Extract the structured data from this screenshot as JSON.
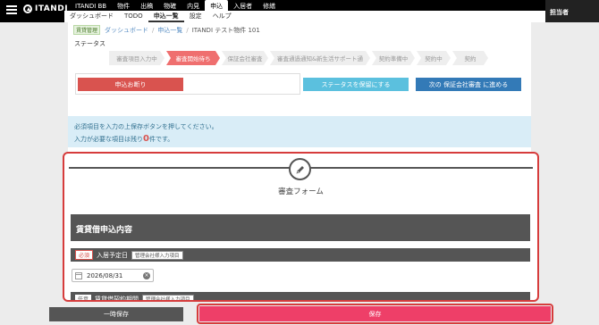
{
  "header": {
    "logo_text": "ITANDI",
    "main_nav": [
      "ITANDI BB",
      "物件",
      "出稿",
      "物確",
      "内見",
      "申込",
      "入居者",
      "修繕"
    ],
    "main_nav_active": "申込",
    "sub_nav": [
      "ダッシュボード",
      "TODO",
      "申込一覧",
      "設定",
      "ヘルプ"
    ],
    "sub_nav_active": "申込一覧",
    "user_label": "担当者"
  },
  "breadcrumb": {
    "tag": "賃貸管理",
    "items": [
      "ダッシュボード",
      "申込一覧",
      "ITANDI テスト物件 101"
    ]
  },
  "status": {
    "label": "ステータス",
    "steps": [
      "審査項目入力中",
      "審査開始待ち",
      "保証会社審査",
      "審査通過通知&新生活サポート通",
      "契約準備中",
      "契約中",
      "契約"
    ],
    "active_step": 1
  },
  "actions": {
    "decline": "申込お断り",
    "hold": "ステータスを保留にする",
    "next": "次の 保証会社審査 に進める"
  },
  "notice": {
    "line1": "必須項目を入力の上保存ボタンを押してください。",
    "line2_prefix": "入力が必要な項目は残り",
    "count": "0",
    "line2_suffix": "件です。"
  },
  "form": {
    "title": "審査フォーム",
    "section_title": "賃貸借申込内容",
    "field1": {
      "required_tag": "必須",
      "label": "入居予定日",
      "mgmt_tag": "管理会社様入力項目",
      "value": "2026/08/31"
    },
    "field2": {
      "optional_tag": "任意",
      "label": "賃貸借契約期間",
      "mgmt_tag": "管理会社様入力項目"
    }
  },
  "footer": {
    "temp_save": "一時保存",
    "save": "保存"
  },
  "colors": {
    "accent_save": "#ee3f68",
    "active_step": "#ef6f6f",
    "highlight_frame": "#d63c3c"
  }
}
